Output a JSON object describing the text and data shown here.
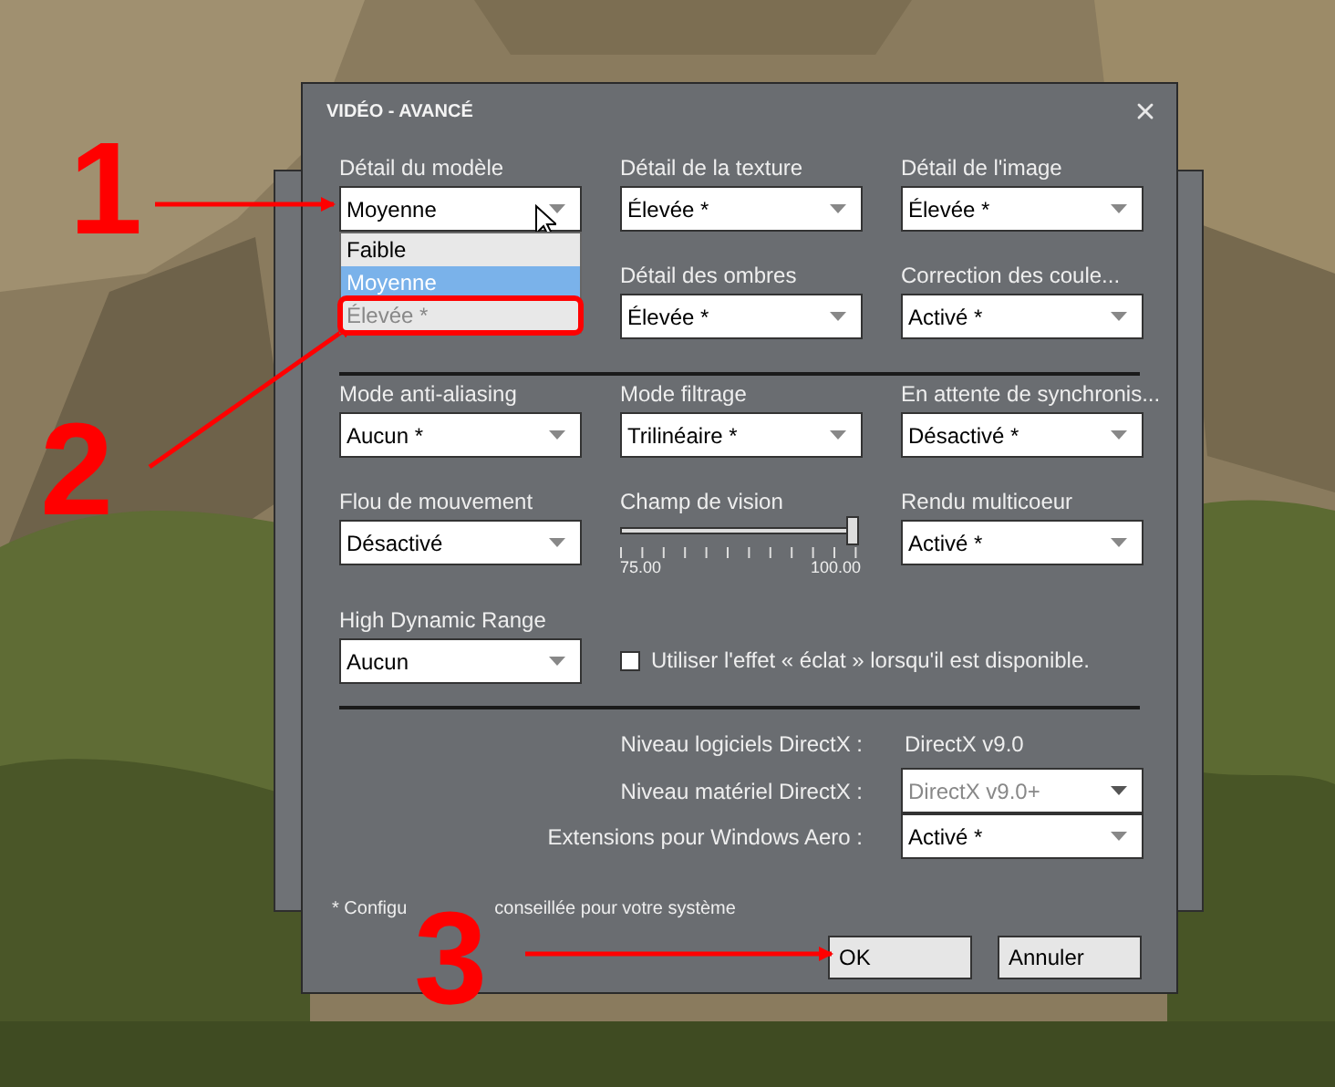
{
  "dialog": {
    "title": "VIDÉO - AVANCÉ",
    "sections": [
      {
        "rows": [
          [
            {
              "kind": "select",
              "label": "Détail du modèle",
              "value": "Moyenne",
              "expanded": true,
              "options": [
                {
                  "label": "Faible",
                  "selected": false,
                  "disabled": false,
                  "circled": false
                },
                {
                  "label": "Moyenne",
                  "selected": true,
                  "disabled": false,
                  "circled": false
                },
                {
                  "label": "Élevée *",
                  "selected": false,
                  "disabled": true,
                  "circled": true
                }
              ]
            },
            {
              "kind": "select",
              "label": "Détail de la texture",
              "value": "Élevée *",
              "expanded": false
            },
            {
              "kind": "select",
              "label": "Détail de l'image",
              "value": "Élevée *",
              "expanded": false
            }
          ],
          [
            "",
            {
              "kind": "select",
              "label": "Détail des ombres",
              "value": "Élevée *",
              "expanded": false
            },
            {
              "kind": "select",
              "label": "Correction des coule...",
              "value": "Activé *",
              "expanded": false
            }
          ]
        ]
      },
      {
        "rows": [
          [
            {
              "kind": "select",
              "label": "Mode anti-aliasing",
              "value": "Aucun *",
              "expanded": false
            },
            {
              "kind": "select",
              "label": "Mode filtrage",
              "value": "Trilinéaire *",
              "expanded": false
            },
            {
              "kind": "select",
              "label": "En attente de synchronis...",
              "value": "Désactivé *",
              "expanded": false
            }
          ],
          [
            {
              "kind": "select",
              "label": "Flou de mouvement",
              "value": "Désactivé",
              "expanded": false
            },
            {
              "kind": "slider",
              "label": "Champ de vision",
              "level": 1,
              "min_label": "75.00",
              "max_label": "100.00"
            },
            {
              "kind": "select",
              "label": "Rendu multicoeur",
              "value": "Activé *",
              "expanded": false
            }
          ],
          [
            {
              "kind": "select",
              "label": "High Dynamic Range",
              "value": "Aucun",
              "expanded": false
            },
            {
              "kind": "checkbox",
              "label": "Utiliser l'effet « éclat » lorsqu'il est disponible.",
              "checked": false
            }
          ]
        ]
      }
    ],
    "directx": [
      {
        "kind": "text",
        "label": "Niveau logiciels DirectX :",
        "value": "DirectX v9.0"
      },
      {
        "kind": "select",
        "label": "Niveau matériel DirectX :",
        "value": "DirectX v9.0+",
        "disabled": true
      },
      {
        "kind": "select",
        "label": "Extensions pour Windows Aero :",
        "value": "Activé *",
        "disabled": false
      }
    ],
    "footnote": [
      "* Configu",
      "conseillée pour votre système"
    ],
    "buttons": [
      {
        "label": "OK"
      },
      {
        "label": "Annuler"
      }
    ]
  },
  "annotations": [
    {
      "number": "1"
    },
    {
      "number": "2"
    },
    {
      "number": "3"
    }
  ]
}
